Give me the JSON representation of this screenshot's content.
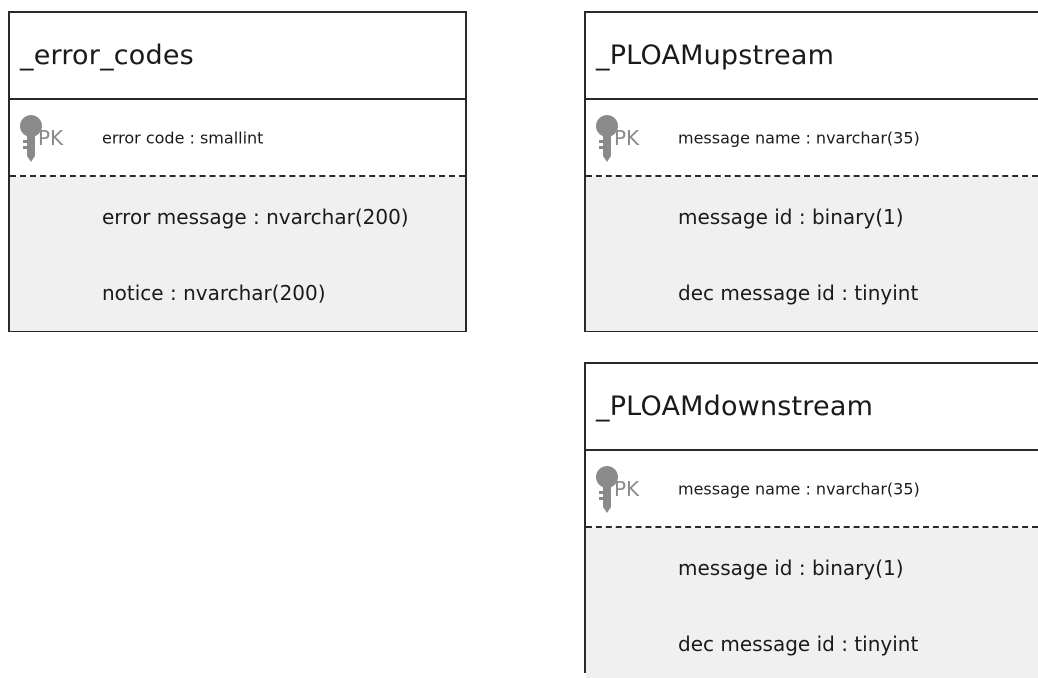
{
  "entities": [
    {
      "name": "_error_codes",
      "pk": {
        "label": "PK",
        "field": "error code : smallint"
      },
      "attributes": [
        "error message : nvarchar(200)",
        "notice : nvarchar(200)"
      ]
    },
    {
      "name": "_PLOAMupstream",
      "pk": {
        "label": "PK",
        "field": "message name : nvarchar(35)"
      },
      "attributes": [
        "message id : binary(1)",
        "dec message id : tinyint"
      ]
    },
    {
      "name": "_PLOAMdownstream",
      "pk": {
        "label": "PK",
        "field": "message name : nvarchar(35)"
      },
      "attributes": [
        "message id : binary(1)",
        "dec message id : tinyint"
      ]
    }
  ],
  "colors": {
    "border": "#2a2a2a",
    "attribute_background": "#f0f0f0",
    "pk_label": "#8a8a8a",
    "key_icon": "#8a8a8a"
  },
  "icons": {
    "primary_key": "key-icon"
  }
}
